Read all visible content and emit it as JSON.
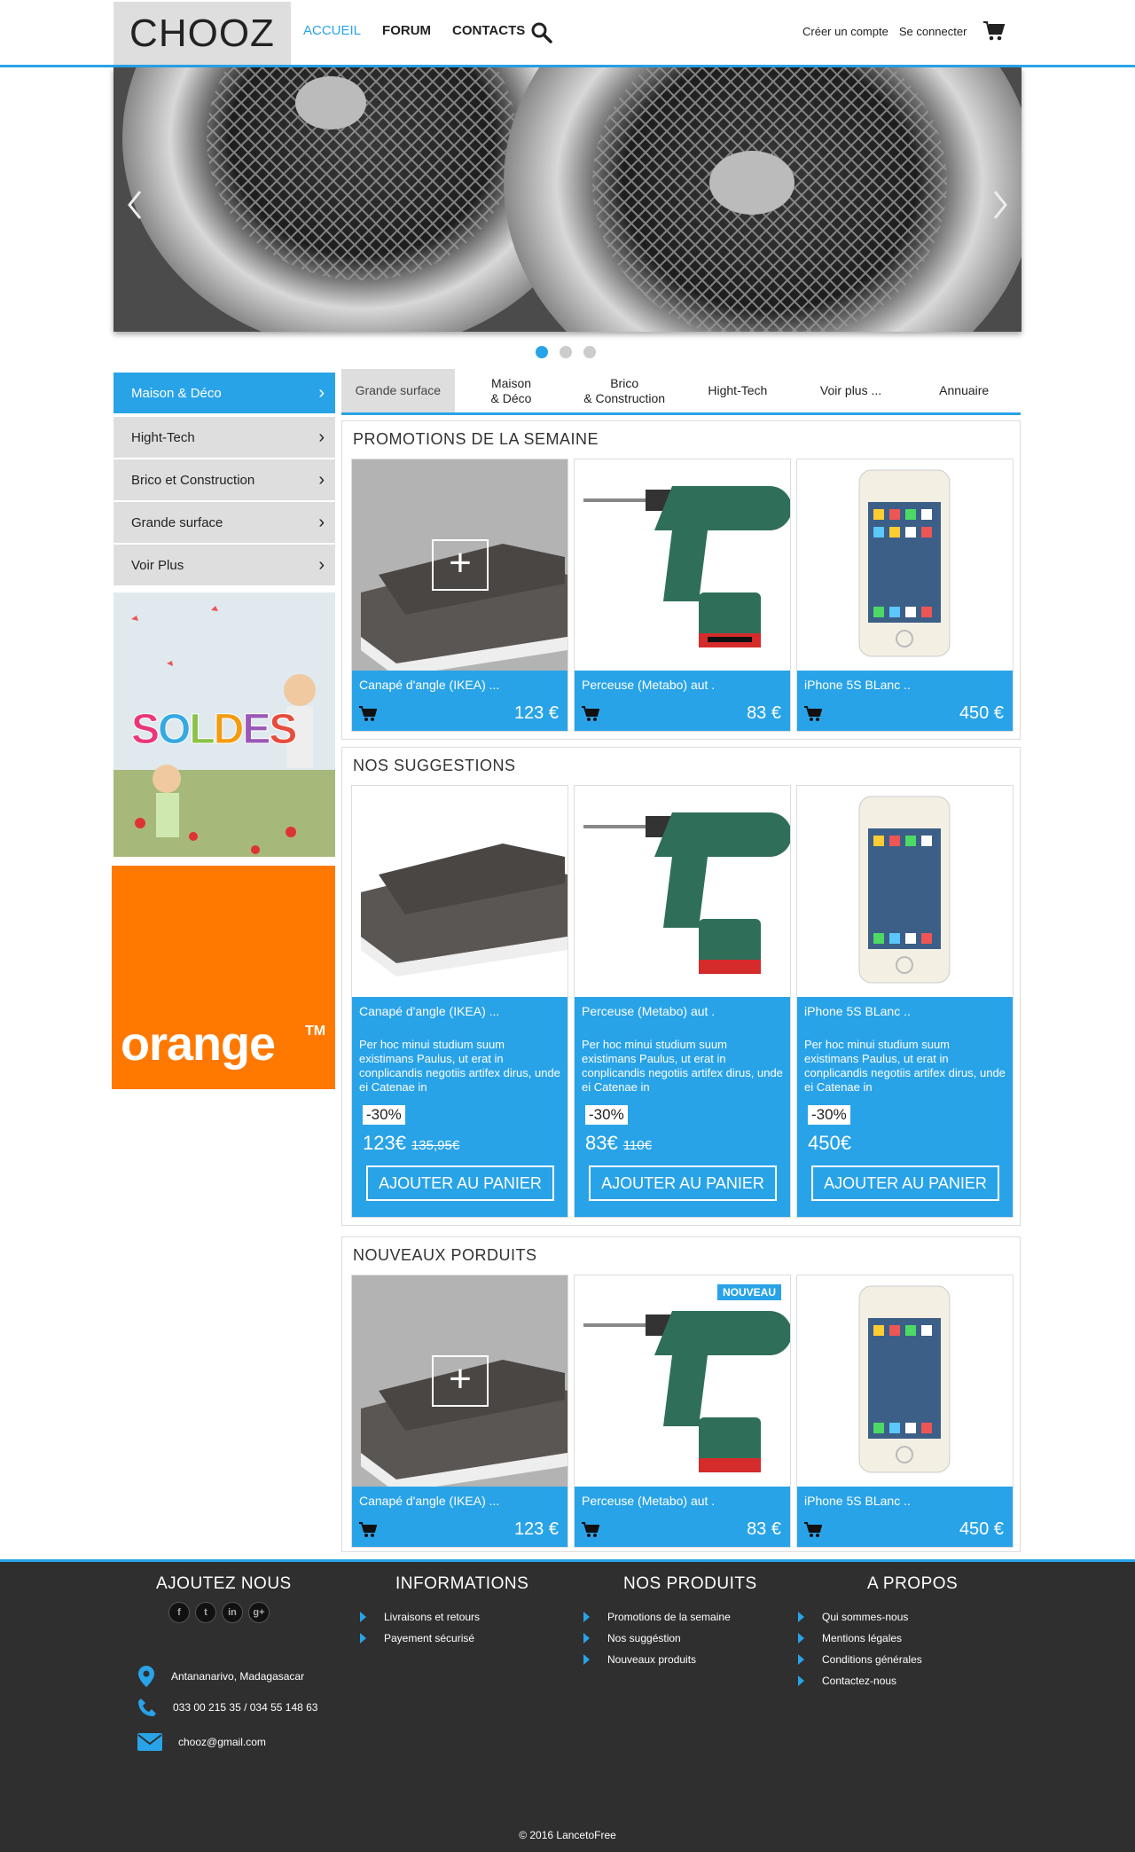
{
  "header": {
    "logo": "CHOOZ",
    "nav": [
      "ACCUEIL",
      "FORUM",
      "CONTACTS"
    ],
    "create_account": "Créer un compte",
    "login": "Se connecter"
  },
  "slider": {
    "active_dot": 0,
    "dot_count": 3
  },
  "sidebar": {
    "items": [
      {
        "label": "Maison & Déco"
      },
      {
        "label": "Hight-Tech"
      },
      {
        "label": "Brico et Construction"
      },
      {
        "label": "Grande surface"
      },
      {
        "label": "Voir Plus"
      }
    ],
    "orange_label": "orange",
    "orange_tm": "TM"
  },
  "tabs": [
    {
      "label": "Grande surface"
    },
    {
      "label": "Maison\n& Déco"
    },
    {
      "label": "Brico\n& Construction"
    },
    {
      "label": "Hight-Tech"
    },
    {
      "label": "Voir plus ..."
    },
    {
      "label": "Annuaire"
    }
  ],
  "promotions": {
    "title": "PROMOTIONS DE LA SEMAINE",
    "items": [
      {
        "name": "Canapé d'angle (IKEA) ...",
        "price": "123 €"
      },
      {
        "name": "Perceuse (Metabo) aut .",
        "price": "83 €"
      },
      {
        "name": "iPhone 5S BLanc ..",
        "price": "450 €"
      }
    ]
  },
  "suggestions": {
    "title": "NOS SUGGESTIONS",
    "items": [
      {
        "name": "Canapé d'angle (IKEA) ...",
        "desc": "Per hoc minui studium suum existimans Paulus, ut erat in conplicandis negotiis artifex dirus, unde ei Catenae in",
        "discount": "-30%",
        "price": "123€",
        "old_price": "135,95€",
        "button": "AJOUTER AU PANIER"
      },
      {
        "name": "Perceuse (Metabo) aut .",
        "desc": "Per hoc minui studium suum existimans Paulus, ut erat in conplicandis negotiis artifex dirus, unde ei Catenae in",
        "discount": "-30%",
        "price": "83€",
        "old_price": "110€",
        "button": "AJOUTER AU PANIER"
      },
      {
        "name": "iPhone 5S BLanc ..",
        "desc": "Per hoc minui studium suum existimans Paulus, ut erat in conplicandis negotiis artifex dirus, unde ei Catenae in",
        "discount": "-30%",
        "price": "450€",
        "old_price": "",
        "button": "AJOUTER AU PANIER"
      }
    ]
  },
  "nouveaux": {
    "title": "NOUVEAUX PORDUITS",
    "badge": "NOUVEAU",
    "items": [
      {
        "name": "Canapé d'angle (IKEA) ...",
        "price": "123 €"
      },
      {
        "name": "Perceuse (Metabo) aut .",
        "price": "83 €"
      },
      {
        "name": "iPhone 5S BLanc ..",
        "price": "450 €"
      }
    ]
  },
  "footer": {
    "col1": {
      "title": "AJOUTEZ NOUS",
      "address": "Antananarivo, Madagasacar",
      "phone": "033 00 215 35 / 034 55 148 63",
      "email": "chooz@gmail.com"
    },
    "col2": {
      "title": "INFORMATIONS",
      "links": [
        "Livraisons et retours",
        "Payement sécurisé"
      ]
    },
    "col3": {
      "title": "NOS PRODUITS",
      "links": [
        "Promotions de la semaine",
        "Nos suggéstion",
        "Nouveaux produits"
      ]
    },
    "col4": {
      "title": "A PROPOS",
      "links": [
        "Qui sommes-nous",
        "Mentions légales",
        "Conditions générales",
        "Contactez-nous"
      ]
    },
    "copyright": "© 2016 LancetoFree"
  },
  "colors": {
    "accent": "#29a3e8",
    "footer_bg": "#2f2f2f",
    "orange": "#ff7900"
  }
}
